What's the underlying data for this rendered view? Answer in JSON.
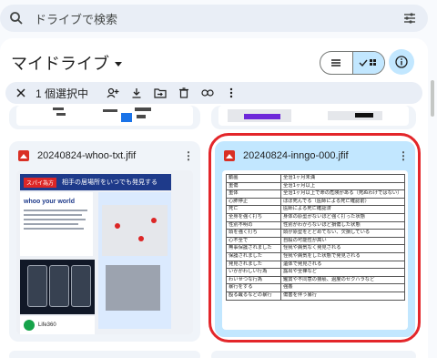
{
  "search": {
    "placeholder": "ドライブで検索"
  },
  "page": {
    "title": "マイドライブ"
  },
  "selection_bar": {
    "count_label": "1 個選択中"
  },
  "files": [
    {
      "name": "20240824-whoo-txt.jfif",
      "selected": false
    },
    {
      "name": "20240824-inngo-000.jfif",
      "selected": true
    }
  ],
  "promo_thumb": {
    "tag": "スパイ為方",
    "headline": "相手の居場所をいつでも発見する",
    "app_name": "whoo your world",
    "footer_app": "Life360"
  },
  "table_rows": [
    [
      "動画",
      "全治1ヶ月未満"
    ],
    [
      "重傷",
      "全治1ヶ月以上"
    ],
    [
      "重体",
      "全治1ヶ月以上で命の危険がある（死ぬわけではない）"
    ],
    [
      "心肺停止",
      "ほぼ死んでる（医師による死亡確認前）"
    ],
    [
      "死亡",
      "医師による死亡確認済"
    ],
    [
      "全身を強く打ち",
      "身体の原型がないほど強く打った状態"
    ],
    [
      "性別不明の",
      "性別がわからないほど損傷した状態"
    ],
    [
      "頭を強く打ち",
      "頭が原型をとどめてない、欠損している"
    ],
    [
      "心不全で",
      "自殺の可能性が高い"
    ],
    [
      "無事保護されました",
      "怪我や病気なく発見される"
    ],
    [
      "保護されました",
      "怪我や病気をした状態で発見される"
    ],
    [
      "発見されました",
      "遺体で発見される"
    ],
    [
      "いかがわしい行為",
      "露出や全裸など"
    ],
    [
      "わいせつな行為",
      "鑑賞や不同意の猥褻、過度のセクハラなど"
    ],
    [
      "暴行をする",
      "強姦"
    ],
    [
      "殴る蹴るなどの暴行",
      "傷害を伴う暴行"
    ]
  ],
  "colors": {
    "selected_bg": "#c2e7ff",
    "highlight_ring": "#e3262a",
    "surface": "#f0f4f9"
  }
}
